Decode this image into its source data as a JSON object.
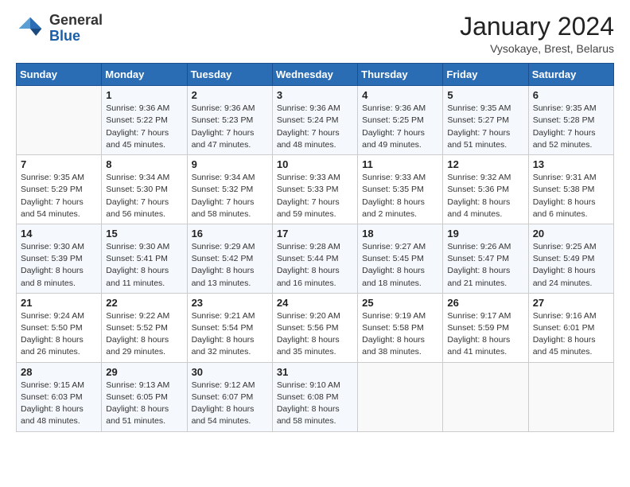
{
  "header": {
    "logo_general": "General",
    "logo_blue": "Blue",
    "month_title": "January 2024",
    "subtitle": "Vysokaye, Brest, Belarus"
  },
  "weekdays": [
    "Sunday",
    "Monday",
    "Tuesday",
    "Wednesday",
    "Thursday",
    "Friday",
    "Saturday"
  ],
  "weeks": [
    [
      {
        "day": "",
        "sunrise": "",
        "sunset": "",
        "daylight": ""
      },
      {
        "day": "1",
        "sunrise": "Sunrise: 9:36 AM",
        "sunset": "Sunset: 5:22 PM",
        "daylight": "Daylight: 7 hours and 45 minutes."
      },
      {
        "day": "2",
        "sunrise": "Sunrise: 9:36 AM",
        "sunset": "Sunset: 5:23 PM",
        "daylight": "Daylight: 7 hours and 47 minutes."
      },
      {
        "day": "3",
        "sunrise": "Sunrise: 9:36 AM",
        "sunset": "Sunset: 5:24 PM",
        "daylight": "Daylight: 7 hours and 48 minutes."
      },
      {
        "day": "4",
        "sunrise": "Sunrise: 9:36 AM",
        "sunset": "Sunset: 5:25 PM",
        "daylight": "Daylight: 7 hours and 49 minutes."
      },
      {
        "day": "5",
        "sunrise": "Sunrise: 9:35 AM",
        "sunset": "Sunset: 5:27 PM",
        "daylight": "Daylight: 7 hours and 51 minutes."
      },
      {
        "day": "6",
        "sunrise": "Sunrise: 9:35 AM",
        "sunset": "Sunset: 5:28 PM",
        "daylight": "Daylight: 7 hours and 52 minutes."
      }
    ],
    [
      {
        "day": "7",
        "sunrise": "Sunrise: 9:35 AM",
        "sunset": "Sunset: 5:29 PM",
        "daylight": "Daylight: 7 hours and 54 minutes."
      },
      {
        "day": "8",
        "sunrise": "Sunrise: 9:34 AM",
        "sunset": "Sunset: 5:30 PM",
        "daylight": "Daylight: 7 hours and 56 minutes."
      },
      {
        "day": "9",
        "sunrise": "Sunrise: 9:34 AM",
        "sunset": "Sunset: 5:32 PM",
        "daylight": "Daylight: 7 hours and 58 minutes."
      },
      {
        "day": "10",
        "sunrise": "Sunrise: 9:33 AM",
        "sunset": "Sunset: 5:33 PM",
        "daylight": "Daylight: 7 hours and 59 minutes."
      },
      {
        "day": "11",
        "sunrise": "Sunrise: 9:33 AM",
        "sunset": "Sunset: 5:35 PM",
        "daylight": "Daylight: 8 hours and 2 minutes."
      },
      {
        "day": "12",
        "sunrise": "Sunrise: 9:32 AM",
        "sunset": "Sunset: 5:36 PM",
        "daylight": "Daylight: 8 hours and 4 minutes."
      },
      {
        "day": "13",
        "sunrise": "Sunrise: 9:31 AM",
        "sunset": "Sunset: 5:38 PM",
        "daylight": "Daylight: 8 hours and 6 minutes."
      }
    ],
    [
      {
        "day": "14",
        "sunrise": "Sunrise: 9:30 AM",
        "sunset": "Sunset: 5:39 PM",
        "daylight": "Daylight: 8 hours and 8 minutes."
      },
      {
        "day": "15",
        "sunrise": "Sunrise: 9:30 AM",
        "sunset": "Sunset: 5:41 PM",
        "daylight": "Daylight: 8 hours and 11 minutes."
      },
      {
        "day": "16",
        "sunrise": "Sunrise: 9:29 AM",
        "sunset": "Sunset: 5:42 PM",
        "daylight": "Daylight: 8 hours and 13 minutes."
      },
      {
        "day": "17",
        "sunrise": "Sunrise: 9:28 AM",
        "sunset": "Sunset: 5:44 PM",
        "daylight": "Daylight: 8 hours and 16 minutes."
      },
      {
        "day": "18",
        "sunrise": "Sunrise: 9:27 AM",
        "sunset": "Sunset: 5:45 PM",
        "daylight": "Daylight: 8 hours and 18 minutes."
      },
      {
        "day": "19",
        "sunrise": "Sunrise: 9:26 AM",
        "sunset": "Sunset: 5:47 PM",
        "daylight": "Daylight: 8 hours and 21 minutes."
      },
      {
        "day": "20",
        "sunrise": "Sunrise: 9:25 AM",
        "sunset": "Sunset: 5:49 PM",
        "daylight": "Daylight: 8 hours and 24 minutes."
      }
    ],
    [
      {
        "day": "21",
        "sunrise": "Sunrise: 9:24 AM",
        "sunset": "Sunset: 5:50 PM",
        "daylight": "Daylight: 8 hours and 26 minutes."
      },
      {
        "day": "22",
        "sunrise": "Sunrise: 9:22 AM",
        "sunset": "Sunset: 5:52 PM",
        "daylight": "Daylight: 8 hours and 29 minutes."
      },
      {
        "day": "23",
        "sunrise": "Sunrise: 9:21 AM",
        "sunset": "Sunset: 5:54 PM",
        "daylight": "Daylight: 8 hours and 32 minutes."
      },
      {
        "day": "24",
        "sunrise": "Sunrise: 9:20 AM",
        "sunset": "Sunset: 5:56 PM",
        "daylight": "Daylight: 8 hours and 35 minutes."
      },
      {
        "day": "25",
        "sunrise": "Sunrise: 9:19 AM",
        "sunset": "Sunset: 5:58 PM",
        "daylight": "Daylight: 8 hours and 38 minutes."
      },
      {
        "day": "26",
        "sunrise": "Sunrise: 9:17 AM",
        "sunset": "Sunset: 5:59 PM",
        "daylight": "Daylight: 8 hours and 41 minutes."
      },
      {
        "day": "27",
        "sunrise": "Sunrise: 9:16 AM",
        "sunset": "Sunset: 6:01 PM",
        "daylight": "Daylight: 8 hours and 45 minutes."
      }
    ],
    [
      {
        "day": "28",
        "sunrise": "Sunrise: 9:15 AM",
        "sunset": "Sunset: 6:03 PM",
        "daylight": "Daylight: 8 hours and 48 minutes."
      },
      {
        "day": "29",
        "sunrise": "Sunrise: 9:13 AM",
        "sunset": "Sunset: 6:05 PM",
        "daylight": "Daylight: 8 hours and 51 minutes."
      },
      {
        "day": "30",
        "sunrise": "Sunrise: 9:12 AM",
        "sunset": "Sunset: 6:07 PM",
        "daylight": "Daylight: 8 hours and 54 minutes."
      },
      {
        "day": "31",
        "sunrise": "Sunrise: 9:10 AM",
        "sunset": "Sunset: 6:08 PM",
        "daylight": "Daylight: 8 hours and 58 minutes."
      },
      {
        "day": "",
        "sunrise": "",
        "sunset": "",
        "daylight": ""
      },
      {
        "day": "",
        "sunrise": "",
        "sunset": "",
        "daylight": ""
      },
      {
        "day": "",
        "sunrise": "",
        "sunset": "",
        "daylight": ""
      }
    ]
  ]
}
